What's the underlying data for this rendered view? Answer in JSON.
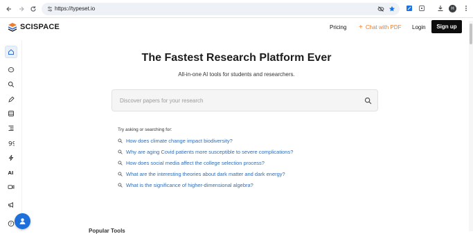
{
  "browser": {
    "url": "https://typeset.io",
    "profile_initial": "H"
  },
  "header": {
    "brand": "SCISPACE",
    "pricing": "Pricing",
    "chat_pdf": "Chat with PDF",
    "login": "Login",
    "signup": "Sign up"
  },
  "hero": {
    "title": "The Fastest Research Platform Ever",
    "subtitle": "All-in-one AI tools for students and researchers."
  },
  "search": {
    "placeholder": "Discover papers for your research"
  },
  "suggestions": {
    "label": "Try asking or searching for:",
    "items": [
      "How does climate change impact biodiversity?",
      "Why are aging Covid patients more susceptible to severe complications?",
      "How does social media affect the college selection process?",
      "What are the interesting theories about dark matter and dark energy?",
      "What is the significance of higher-dimensional algebra?"
    ]
  },
  "bottom_text": "Popular Tools",
  "colors": {
    "accent": "#f07b2e",
    "link": "#2f6db5",
    "fab": "#1e6fd9"
  }
}
